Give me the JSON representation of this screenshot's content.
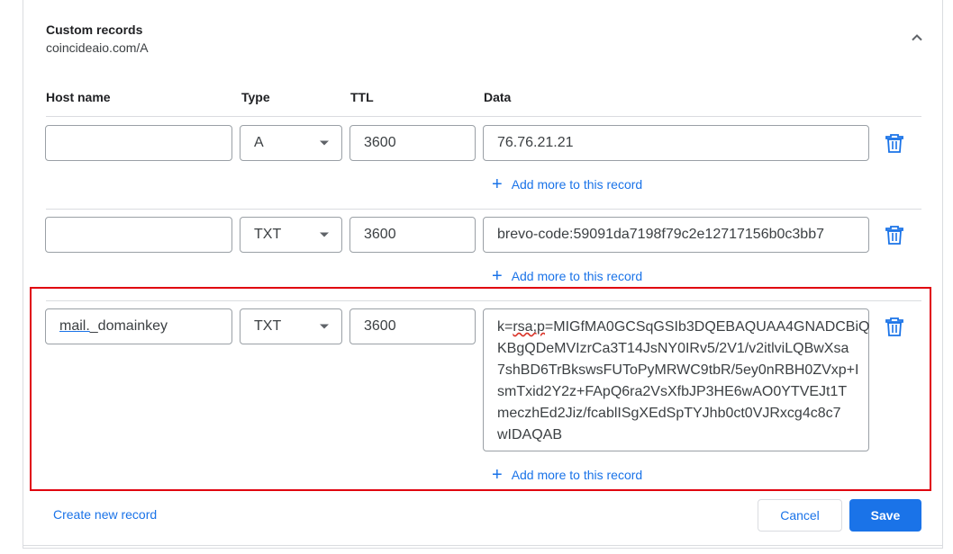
{
  "section": {
    "title": "Custom records",
    "subtitle": "coincideaio.com/A"
  },
  "columns": {
    "host": "Host name",
    "type": "Type",
    "ttl": "TTL",
    "data": "Data"
  },
  "records": [
    {
      "host": "",
      "type": "A",
      "ttl": "3600",
      "data": "76.76.21.21",
      "add_more": "Add more to this record"
    },
    {
      "host": "",
      "type": "TXT",
      "ttl": "3600",
      "data": "brevo-code:59091da7198f79c2e12717156b0c3bb7",
      "add_more": "Add more to this record"
    },
    {
      "host_prefix": "mail.",
      "host_suffix": "_domainkey",
      "type": "TXT",
      "ttl": "3600",
      "data_prefix": "k=",
      "data_misspelled": "rsa;p",
      "data_rest": "=MIGfMA0GCSqGSIb3DQEBAQUAA4GNADCBiQ\nKBgQDeMVIzrCa3T14JsNY0IRv5/2V1/v2itlviLQBwXsa\n7shBD6TrBkswsFUToPyMRWC9tbR/5ey0nRBH0ZVxp+I\nsmTxid2Y2z+FApQ6ra2VsXfbJP3HE6wAO0YTVEJt1T\nmeczhEd2Jiz/fcablISgXEdSpTYJhb0ct0VJRxcg4c8c7\nwIDAQAB",
      "add_more": "Add more to this record"
    }
  ],
  "actions": {
    "create": "Create new record",
    "cancel": "Cancel",
    "save": "Save"
  },
  "colors": {
    "accent": "#1a73e8",
    "highlight": "#e0000f"
  }
}
